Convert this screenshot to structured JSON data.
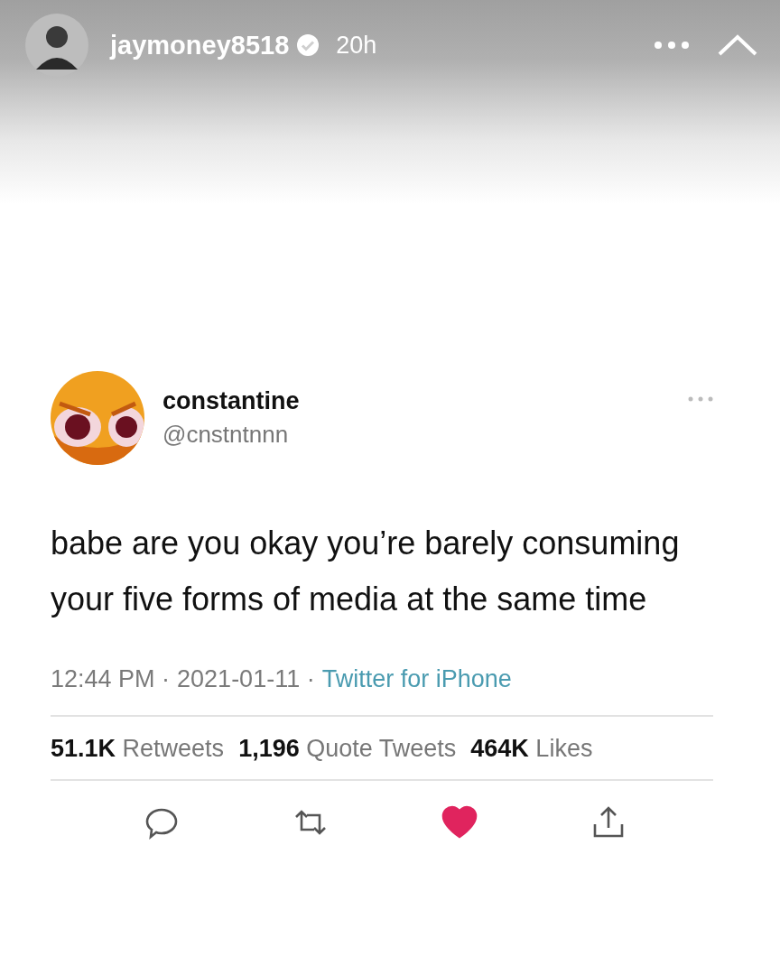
{
  "story": {
    "username": "jaymoney8518",
    "verified": true,
    "time": "20h"
  },
  "tweet": {
    "name": "constantine",
    "handle": "@cnstntnnn",
    "text": "babe are you okay you’re barely consuming your five forms of media at the same time",
    "time": "12:44 PM ·",
    "date": "2021-01-11 ·",
    "source": "Twitter for iPhone",
    "stats": [
      {
        "count": "51.1K",
        "label": "Retweets"
      },
      {
        "count": "1,196",
        "label": "Quote Tweets"
      },
      {
        "count": "464K",
        "label": "Likes"
      }
    ],
    "liked": true
  }
}
